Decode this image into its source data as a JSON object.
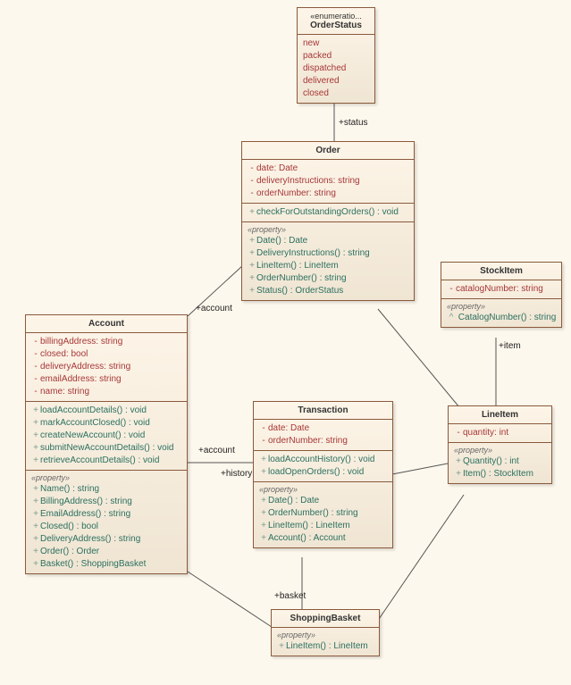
{
  "diagram": {
    "classes": {
      "orderStatus": {
        "stereotype": "«enumeratio...",
        "name": "OrderStatus",
        "literals": [
          "new",
          "packed",
          "dispatched",
          "delivered",
          "closed"
        ]
      },
      "order": {
        "name": "Order",
        "attributes": [
          "date: Date",
          "deliveryInstructions: string",
          "orderNumber: string"
        ],
        "operationsTop": [
          "checkForOutstandingOrders() : void"
        ],
        "propertyLabel": "«property»",
        "properties": [
          "Date() : Date",
          "DeliveryInstructions() : string",
          "LineItem() : LineItem",
          "OrderNumber() : string",
          "Status() : OrderStatus"
        ]
      },
      "stockItem": {
        "name": "StockItem",
        "attributes": [
          "catalogNumber: string"
        ],
        "propertyLabel": "«property»",
        "properties": [
          "CatalogNumber() : string"
        ],
        "propVis": "^"
      },
      "account": {
        "name": "Account",
        "attributes": [
          "billingAddress: string",
          "closed: bool",
          "deliveryAddress: string",
          "emailAddress: string",
          "name: string"
        ],
        "operations": [
          "loadAccountDetails() : void",
          "markAccountClosed() : void",
          "createNewAccount() : void",
          "submitNewAccountDetails() : void",
          "retrieveAccountDetails() : void"
        ],
        "propertyLabel": "«property»",
        "properties": [
          "Name() : string",
          "BillingAddress() : string",
          "EmailAddress() : string",
          "Closed() : bool",
          "DeliveryAddress() : string",
          "Order() : Order",
          "Basket() : ShoppingBasket"
        ]
      },
      "transaction": {
        "name": "Transaction",
        "attributes": [
          "date: Date",
          "orderNumber: string"
        ],
        "operations": [
          "loadAccountHistory() : void",
          "loadOpenOrders() : void"
        ],
        "propertyLabel": "«property»",
        "properties": [
          "Date() : Date",
          "OrderNumber() : string",
          "LineItem() : LineItem",
          "Account() : Account"
        ]
      },
      "lineItem": {
        "name": "LineItem",
        "attributes": [
          "quantity: int"
        ],
        "propertyLabel": "«property»",
        "properties": [
          "Quantity() : int",
          "Item() : StockItem"
        ]
      },
      "shoppingBasket": {
        "name": "ShoppingBasket",
        "propertyLabel": "«property»",
        "properties": [
          "LineItem() : LineItem"
        ]
      }
    },
    "roles": {
      "status": "+status",
      "accountOrder": "+account",
      "item": "+item",
      "accountTxn": "+account",
      "history": "+history",
      "basket": "+basket"
    }
  },
  "chart_data": {
    "type": "uml-class-diagram",
    "classes": [
      {
        "name": "OrderStatus",
        "stereotype": "enumeration",
        "literals": [
          "new",
          "packed",
          "dispatched",
          "delivered",
          "closed"
        ]
      },
      {
        "name": "Order",
        "attributes": [
          {
            "name": "date",
            "type": "Date",
            "vis": "-"
          },
          {
            "name": "deliveryInstructions",
            "type": "string",
            "vis": "-"
          },
          {
            "name": "orderNumber",
            "type": "string",
            "vis": "-"
          }
        ],
        "operations": [
          {
            "name": "checkForOutstandingOrders",
            "return": "void",
            "vis": "+"
          }
        ],
        "properties": [
          {
            "name": "Date",
            "return": "Date",
            "vis": "+"
          },
          {
            "name": "DeliveryInstructions",
            "return": "string",
            "vis": "+"
          },
          {
            "name": "LineItem",
            "return": "LineItem",
            "vis": "+"
          },
          {
            "name": "OrderNumber",
            "return": "string",
            "vis": "+"
          },
          {
            "name": "Status",
            "return": "OrderStatus",
            "vis": "+"
          }
        ]
      },
      {
        "name": "StockItem",
        "attributes": [
          {
            "name": "catalogNumber",
            "type": "string",
            "vis": "-"
          }
        ],
        "properties": [
          {
            "name": "CatalogNumber",
            "return": "string",
            "vis": "^"
          }
        ]
      },
      {
        "name": "Account",
        "attributes": [
          {
            "name": "billingAddress",
            "type": "string",
            "vis": "-"
          },
          {
            "name": "closed",
            "type": "bool",
            "vis": "-"
          },
          {
            "name": "deliveryAddress",
            "type": "string",
            "vis": "-"
          },
          {
            "name": "emailAddress",
            "type": "string",
            "vis": "-"
          },
          {
            "name": "name",
            "type": "string",
            "vis": "-"
          }
        ],
        "operations": [
          {
            "name": "loadAccountDetails",
            "return": "void",
            "vis": "+"
          },
          {
            "name": "markAccountClosed",
            "return": "void",
            "vis": "+"
          },
          {
            "name": "createNewAccount",
            "return": "void",
            "vis": "+"
          },
          {
            "name": "submitNewAccountDetails",
            "return": "void",
            "vis": "+"
          },
          {
            "name": "retrieveAccountDetails",
            "return": "void",
            "vis": "+"
          }
        ],
        "properties": [
          {
            "name": "Name",
            "return": "string",
            "vis": "+"
          },
          {
            "name": "BillingAddress",
            "return": "string",
            "vis": "+"
          },
          {
            "name": "EmailAddress",
            "return": "string",
            "vis": "+"
          },
          {
            "name": "Closed",
            "return": "bool",
            "vis": "+"
          },
          {
            "name": "DeliveryAddress",
            "return": "string",
            "vis": "+"
          },
          {
            "name": "Order",
            "return": "Order",
            "vis": "+"
          },
          {
            "name": "Basket",
            "return": "ShoppingBasket",
            "vis": "+"
          }
        ]
      },
      {
        "name": "Transaction",
        "attributes": [
          {
            "name": "date",
            "type": "Date",
            "vis": "-"
          },
          {
            "name": "orderNumber",
            "type": "string",
            "vis": "-"
          }
        ],
        "operations": [
          {
            "name": "loadAccountHistory",
            "return": "void",
            "vis": "+"
          },
          {
            "name": "loadOpenOrders",
            "return": "void",
            "vis": "+"
          }
        ],
        "properties": [
          {
            "name": "Date",
            "return": "Date",
            "vis": "+"
          },
          {
            "name": "OrderNumber",
            "return": "string",
            "vis": "+"
          },
          {
            "name": "LineItem",
            "return": "LineItem",
            "vis": "+"
          },
          {
            "name": "Account",
            "return": "Account",
            "vis": "+"
          }
        ]
      },
      {
        "name": "LineItem",
        "attributes": [
          {
            "name": "quantity",
            "type": "int",
            "vis": "-"
          }
        ],
        "properties": [
          {
            "name": "Quantity",
            "return": "int",
            "vis": "+"
          },
          {
            "name": "Item",
            "return": "StockItem",
            "vis": "+"
          }
        ]
      },
      {
        "name": "ShoppingBasket",
        "properties": [
          {
            "name": "LineItem",
            "return": "LineItem",
            "vis": "+"
          }
        ]
      }
    ],
    "associations": [
      {
        "from": "Order",
        "to": "OrderStatus",
        "role": "+status"
      },
      {
        "from": "Order",
        "to": "Account",
        "role": "+account"
      },
      {
        "from": "Order",
        "to": "LineItem"
      },
      {
        "from": "LineItem",
        "to": "StockItem",
        "role": "+item"
      },
      {
        "from": "Transaction",
        "to": "Account",
        "roleFrom": "+history",
        "roleTo": "+account"
      },
      {
        "from": "Transaction",
        "to": "LineItem"
      },
      {
        "from": "ShoppingBasket",
        "to": "Account",
        "role": "+basket"
      },
      {
        "from": "ShoppingBasket",
        "to": "LineItem"
      }
    ]
  }
}
